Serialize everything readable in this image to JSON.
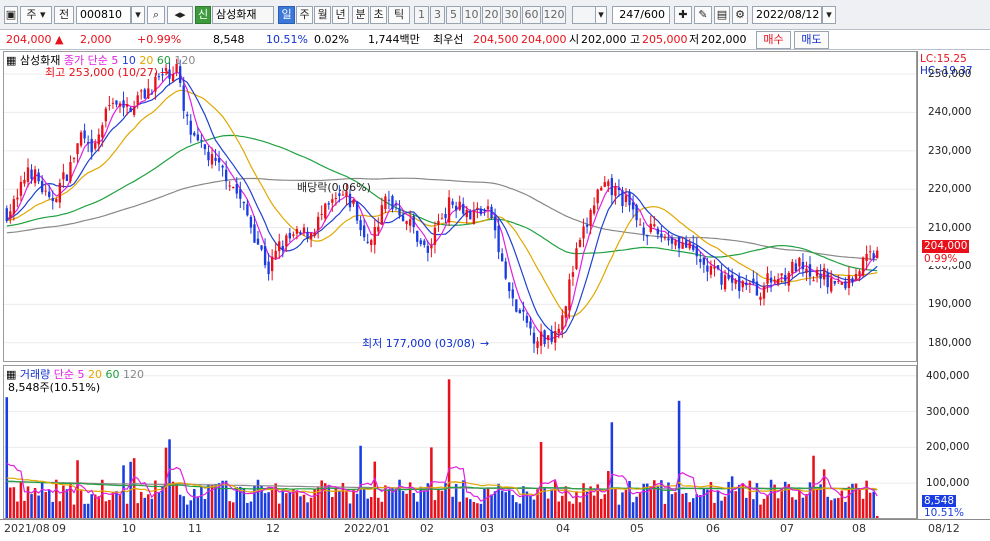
{
  "toolbar": {
    "period_label": "주",
    "prefix_label": "전",
    "stock_code": "000810",
    "credit_label": "신",
    "stock_name": "삼성화재",
    "tf_day": "일",
    "tf_week": "주",
    "tf_month": "월",
    "tf_year": "년",
    "tf_min": "분",
    "tf_sec": "초",
    "tf_tick": "틱",
    "intervals": [
      "1",
      "3",
      "5",
      "10",
      "20",
      "30",
      "60",
      "120"
    ],
    "count": "247/600",
    "date": "2022/08/12"
  },
  "quote": {
    "price": "204,000",
    "change": "2,000",
    "pct": "+0.99%",
    "volume": "8,548",
    "vol_ratio": "10.51%",
    "turnover": "0.02%",
    "amount": "1,744백만",
    "best_label": "최우선",
    "ask": "204,500",
    "bid": "204,000",
    "open_label": "시",
    "open": "202,000",
    "high_label": "고",
    "high": "205,000",
    "low_label": "저",
    "low": "202,000",
    "buy_label": "매수",
    "sell_label": "매도"
  },
  "colors": {
    "up": "#e8101a",
    "down": "#1a3ce0",
    "ma5": "#e020e0",
    "ma10": "#2040d0",
    "ma20": "#e0a800",
    "ma60": "#20a040",
    "ma120": "#888888"
  },
  "price_legend": {
    "name": "삼성화재",
    "item": "종가 단순",
    "p5": "5",
    "p10": "10",
    "p20": "20",
    "p60": "60",
    "p120": "120"
  },
  "vol_legend": {
    "name": "거래량",
    "item": "단순",
    "p5": "5",
    "p20": "20",
    "p60": "60",
    "p120": "120",
    "last": "8,548주(10.51%)"
  },
  "annotations": {
    "high": "최고 253,000 (10/27)",
    "low": "최저 177,000 (03/08)",
    "dividend": "배당락(0.06%)"
  },
  "right": {
    "lc": "LC:15.25",
    "hc": "HC:-19.37",
    "price_ticks": [
      "250,000",
      "240,000",
      "230,000",
      "220,000",
      "210,000",
      "200,000",
      "190,000",
      "180,000"
    ],
    "vol_ticks": [
      "400,000",
      "300,000",
      "200,000",
      "100,000"
    ],
    "last_price": "204,000",
    "last_pct": "0.99%",
    "last_vol": "8,548",
    "last_vol_pct": "10.51%"
  },
  "date_labels": [
    "2021/08",
    "09",
    "10",
    "11",
    "12",
    "2022/01",
    "02",
    "03",
    "04",
    "05",
    "06",
    "07",
    "08",
    "08/12"
  ],
  "chart_data": {
    "type": "candlestick",
    "title": "삼성화재",
    "ylim": [
      175000,
      256000
    ],
    "vol_ylim": [
      0,
      430000
    ],
    "anchors": [
      [
        0,
        214000
      ],
      [
        3,
        217000
      ],
      [
        6,
        226000
      ],
      [
        9,
        222000
      ],
      [
        12,
        216000
      ],
      [
        15,
        221000
      ],
      [
        18,
        226000
      ],
      [
        21,
        234000
      ],
      [
        24,
        228000
      ],
      [
        27,
        237000
      ],
      [
        30,
        244000
      ],
      [
        33,
        240000
      ],
      [
        36,
        243000
      ],
      [
        39,
        245000
      ],
      [
        42,
        248000
      ],
      [
        45,
        250000
      ],
      [
        48,
        252000
      ],
      [
        50,
        240000
      ],
      [
        53,
        232000
      ],
      [
        56,
        230000
      ],
      [
        59,
        226000
      ],
      [
        62,
        224000
      ],
      [
        65,
        219000
      ],
      [
        68,
        213000
      ],
      [
        71,
        206000
      ],
      [
        74,
        199000
      ],
      [
        77,
        205000
      ],
      [
        80,
        207000
      ],
      [
        83,
        208000
      ],
      [
        86,
        209000
      ],
      [
        89,
        213000
      ],
      [
        92,
        216000
      ],
      [
        95,
        218000
      ],
      [
        98,
        216000
      ],
      [
        101,
        206000
      ],
      [
        104,
        209000
      ],
      [
        107,
        217000
      ],
      [
        110,
        216000
      ],
      [
        113,
        212000
      ],
      [
        116,
        208000
      ],
      [
        119,
        203000
      ],
      [
        122,
        212000
      ],
      [
        125,
        216000
      ],
      [
        128,
        217000
      ],
      [
        131,
        213000
      ],
      [
        134,
        215000
      ],
      [
        137,
        213000
      ],
      [
        140,
        200000
      ],
      [
        143,
        190000
      ],
      [
        146,
        186000
      ],
      [
        149,
        182000
      ],
      [
        152,
        181000
      ],
      [
        155,
        183000
      ],
      [
        158,
        191000
      ],
      [
        161,
        203000
      ],
      [
        164,
        211000
      ],
      [
        167,
        219000
      ],
      [
        170,
        220000
      ],
      [
        173,
        219000
      ],
      [
        176,
        215000
      ],
      [
        179,
        211000
      ],
      [
        182,
        209000
      ],
      [
        185,
        208000
      ],
      [
        188,
        207000
      ],
      [
        191,
        206000
      ],
      [
        194,
        203000
      ],
      [
        197,
        200000
      ],
      [
        200,
        198000
      ],
      [
        203,
        197000
      ],
      [
        206,
        195000
      ],
      [
        209,
        196000
      ],
      [
        212,
        193000
      ],
      [
        215,
        196000
      ],
      [
        218,
        197000
      ],
      [
        221,
        199000
      ],
      [
        224,
        200000
      ],
      [
        227,
        196000
      ],
      [
        230,
        198000
      ],
      [
        233,
        196000
      ],
      [
        236,
        195000
      ],
      [
        239,
        197000
      ],
      [
        242,
        201000
      ],
      [
        244,
        203000
      ],
      [
        246,
        204000
      ]
    ],
    "count": 247,
    "last": {
      "close": 204000,
      "open": 202000,
      "high": 205000,
      "low": 202000,
      "volume": 8548
    }
  }
}
